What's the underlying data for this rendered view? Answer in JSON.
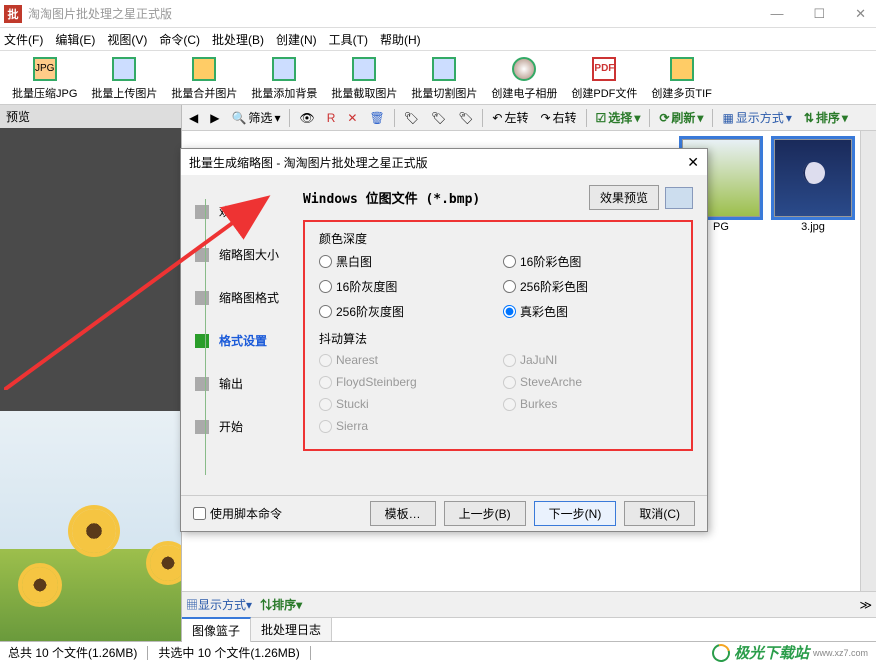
{
  "app": {
    "title": "淘淘图片批处理之星正式版",
    "icon_text": "批"
  },
  "menu": [
    "文件(F)",
    "编辑(E)",
    "视图(V)",
    "命令(C)",
    "批处理(B)",
    "创建(N)",
    "工具(T)",
    "帮助(H)"
  ],
  "toolbar": [
    {
      "label": "批量压缩JPG"
    },
    {
      "label": "批量上传图片"
    },
    {
      "label": "批量合并图片"
    },
    {
      "label": "批量添加背景"
    },
    {
      "label": "批量截取图片"
    },
    {
      "label": "批量切割图片"
    },
    {
      "label": "创建电子相册"
    },
    {
      "label": "创建PDF文件"
    },
    {
      "label": "创建多页TIF"
    }
  ],
  "preview": {
    "header": "预览"
  },
  "subtoolbar": {
    "filter": "筛选",
    "rotate_left": "左转",
    "rotate_right": "右转",
    "select": "选择",
    "refresh": "刷新",
    "display": "显示方式",
    "sort": "排序"
  },
  "thumbs": [
    {
      "name": "PG"
    },
    {
      "name": "3.jpg"
    }
  ],
  "bottom_tabs": [
    "图像篮子",
    "批处理日志"
  ],
  "status": {
    "total": "总共 10 个文件(1.26MB)",
    "selected": "共选中 10 个文件(1.26MB)",
    "brand": "极光下载站",
    "brand_url": "www.xz7.com"
  },
  "dialog": {
    "title": "批量生成缩略图 - 淘淘图片批处理之星正式版",
    "steps": [
      "欢迎",
      "缩略图大小",
      "缩略图格式",
      "格式设置",
      "输出",
      "开始"
    ],
    "active_step": "格式设置",
    "format_label": "Windows 位图文件 (*.bmp)",
    "preview_btn": "效果预览",
    "color_depth": {
      "legend": "颜色深度",
      "options": [
        "黑白图",
        "16阶彩色图",
        "16阶灰度图",
        "256阶彩色图",
        "256阶灰度图",
        "真彩色图"
      ],
      "selected": "真彩色图"
    },
    "dither": {
      "legend": "抖动算法",
      "options": [
        "Nearest",
        "JaJuNI",
        "FloydSteinberg",
        "SteveArche",
        "Stucki",
        "Burkes",
        "Sierra"
      ]
    },
    "use_script": "使用脚本命令",
    "buttons": {
      "template": "模板…",
      "prev": "上一步(B)",
      "next": "下一步(N)",
      "cancel": "取消(C)"
    }
  }
}
